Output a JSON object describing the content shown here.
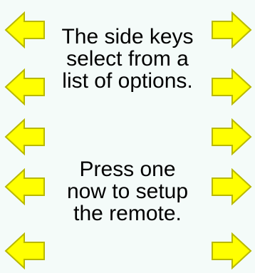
{
  "colors": {
    "background": "#f4fbf9",
    "key_fill": "#ffff00",
    "key_outline": "#b8b800",
    "text": "#000000"
  },
  "side_keys": {
    "left": [
      "arrow-left-icon",
      "arrow-left-icon",
      "arrow-left-icon",
      "arrow-left-icon",
      "arrow-left-icon"
    ],
    "right": [
      "arrow-right-icon",
      "arrow-right-icon",
      "arrow-right-icon",
      "arrow-right-icon",
      "arrow-right-icon"
    ]
  },
  "message1": {
    "line1": "The side keys",
    "line2": "select from a",
    "line3": "list of options."
  },
  "message2": {
    "line1": "Press one",
    "line2": "now to setup",
    "line3": "the remote."
  }
}
